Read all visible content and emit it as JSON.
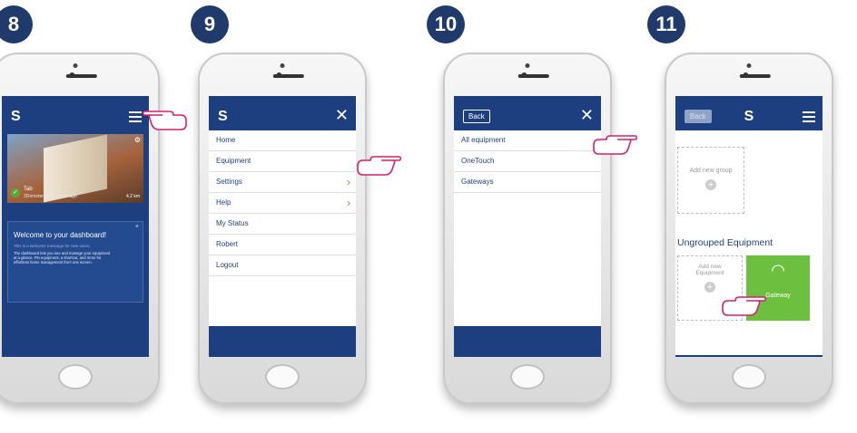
{
  "steps": [
    "8",
    "9",
    "10",
    "11"
  ],
  "colors": {
    "accent": "#1e3f7f",
    "badge": "#1f3a6b",
    "green": "#6cbf3f",
    "hand": "#d6206e"
  },
  "phone8": {
    "hero_name": "Tab",
    "hero_sub": "3Dometer 10 seconds ago",
    "hero_val": "4.2 km",
    "welcome_title": "Welcome to your dashboard!",
    "welcome_line1": "This is a welcome message for new users.",
    "welcome_body": "The dashboard lets you see and manage your equipment at a glance. Pin equipment, a shortcut, and more for effortless home management from one screen."
  },
  "phone9": {
    "menu": [
      {
        "label": "Home",
        "chevron": false
      },
      {
        "label": "Equipment",
        "chevron": false
      },
      {
        "label": "Settings",
        "chevron": true
      },
      {
        "label": "Help",
        "chevron": true
      },
      {
        "label": "My Status",
        "chevron": false
      },
      {
        "label": "Robert",
        "chevron": false
      },
      {
        "label": "Logout",
        "chevron": false
      }
    ]
  },
  "phone10": {
    "back_label": "Back",
    "menu": [
      "All equipment",
      "OneTouch",
      "Gateways"
    ]
  },
  "phone11": {
    "back_label": "Back",
    "add_group_label": "Add new group",
    "section_title": "Ungrouped Equipment",
    "add_equipment_label": "Add new Equipment",
    "gateway_label": "Gateway"
  }
}
